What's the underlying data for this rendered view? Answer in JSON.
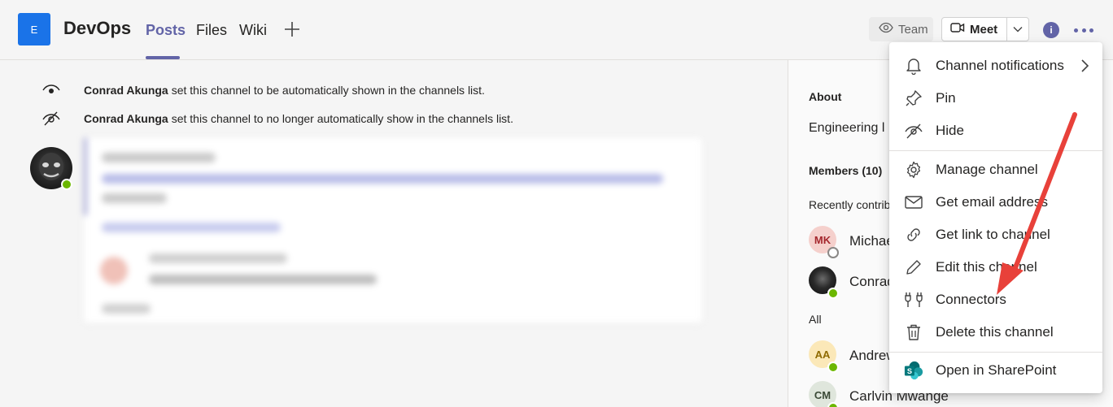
{
  "header": {
    "team_initial": "E",
    "channel_name": "DevOps",
    "tabs": [
      {
        "label": "Posts",
        "active": true
      },
      {
        "label": "Files",
        "active": false
      },
      {
        "label": "Wiki",
        "active": false
      }
    ],
    "add_tab_icon": "plus-icon",
    "team_button_label": "Team",
    "meet_button_label": "Meet",
    "info_label": "i",
    "accent_color": "#6264a7"
  },
  "feed": {
    "system_messages": [
      {
        "icon": "eye-icon",
        "actor": "Conrad Akunga",
        "text": "set this channel to be automatically shown in the channels list."
      },
      {
        "icon": "eye-off-icon",
        "actor": "Conrad Akunga",
        "text": "set this channel to no longer automatically show in the channels list."
      }
    ]
  },
  "right_pane": {
    "about_label": "About",
    "about_text": "Engineering l",
    "members_label": "Members (10)",
    "recent_label": "Recently contrib",
    "all_label": "All",
    "recent_members": [
      {
        "initials": "MK",
        "name": "Michae",
        "status": "offline"
      },
      {
        "initials": "",
        "name": "Conrad",
        "status": "available"
      }
    ],
    "all_members": [
      {
        "initials": "AA",
        "name": "Andrew",
        "status": "available"
      },
      {
        "initials": "CM",
        "name": "Carlvin Mwange",
        "status": "available"
      }
    ]
  },
  "menu": {
    "items": [
      {
        "label": "Channel notifications",
        "icon": "bell-icon",
        "has_submenu": true
      },
      {
        "label": "Pin",
        "icon": "pin-icon"
      },
      {
        "label": "Hide",
        "icon": "eye-off-icon"
      },
      {
        "label": "Manage channel",
        "icon": "gear-icon"
      },
      {
        "label": "Get email address",
        "icon": "mail-icon"
      },
      {
        "label": "Get link to channel",
        "icon": "link-icon"
      },
      {
        "label": "Edit this channel",
        "icon": "pencil-icon"
      },
      {
        "label": "Connectors",
        "icon": "plug-icon"
      },
      {
        "label": "Delete this channel",
        "icon": "trash-icon"
      },
      {
        "label": "Open in SharePoint",
        "icon": "sharepoint-icon"
      }
    ]
  },
  "annotation": {
    "arrow_color": "#e8413a",
    "target": "Connectors"
  }
}
